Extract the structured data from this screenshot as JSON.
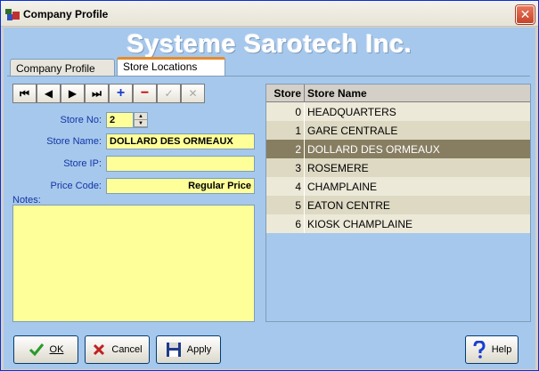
{
  "window": {
    "title": "Company Profile",
    "close_glyph": "✕"
  },
  "banner": {
    "text": "Systeme Sarotech Inc."
  },
  "tabs": [
    {
      "label": "Company Profile",
      "active": false
    },
    {
      "label": "Store Locations",
      "active": true
    }
  ],
  "navigator": {
    "first": "⏮",
    "prev": "◀",
    "next": "▶",
    "last": "⏭",
    "add": "+",
    "delete": "−",
    "post": "✓",
    "cancel": "✕"
  },
  "form": {
    "store_no_label": "Store No:",
    "store_no_value": "2",
    "store_name_label": "Store Name:",
    "store_name_value": "DOLLARD DES ORMEAUX",
    "store_ip_label": "Store IP:",
    "store_ip_value": "",
    "price_code_label": "Price Code:",
    "price_code_value": "Regular Price",
    "notes_label": "Notes:",
    "notes_value": ""
  },
  "grid": {
    "columns": [
      "Store",
      "Store Name"
    ],
    "rows": [
      {
        "store": "0",
        "name": "HEADQUARTERS"
      },
      {
        "store": "1",
        "name": "GARE CENTRALE"
      },
      {
        "store": "2",
        "name": "DOLLARD DES ORMEAUX"
      },
      {
        "store": "3",
        "name": "ROSEMERE"
      },
      {
        "store": "4",
        "name": "CHAMPLAINE"
      },
      {
        "store": "5",
        "name": "EATON CENTRE"
      },
      {
        "store": "6",
        "name": "KIOSK CHAMPLAINE"
      }
    ],
    "selected_index": 2
  },
  "footer": {
    "ok_label": "OK",
    "cancel_label": "Cancel",
    "apply_label": "Apply",
    "help_label": "Help"
  },
  "colors": {
    "client_bg": "#a6c8ec",
    "field_bg": "#ffff99",
    "selected_row": "#877d61",
    "label_text": "#1235a8"
  }
}
